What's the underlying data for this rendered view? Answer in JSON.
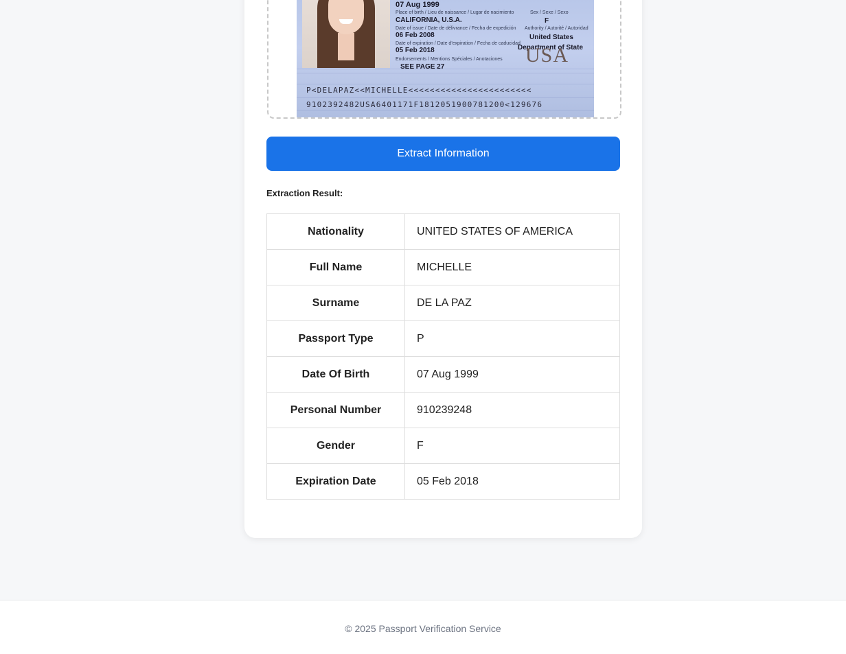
{
  "passport_image": {
    "date_of_birth": "07 Aug 1999",
    "place_of_birth_label": "Place of birth / Lieu de naissance / Lugar de nacimiento",
    "place_of_birth": "CALIFORNIA, U.S.A.",
    "sex_label": "Sex / Sexe / Sexo",
    "sex": "F",
    "issue_label": "Date of issue / Date de délivrance / Fecha de expedición",
    "issue_date": "06 Feb 2008",
    "authority_label": "Authority / Autorité / Autoridad",
    "authority_line1": "United States",
    "authority_line2": "Department of State",
    "expiration_label": "Date of expiration / Date d'expiration / Fecha de caducidad",
    "expiration_date": "05 Feb 2018",
    "endorsements_label": "Endorsements / Mentions Spéciales / Anotaciones",
    "endorsements": "SEE PAGE 27",
    "country_mark": "USA",
    "mrz_line1": "P<DELAPAZ<<MICHELLE<<<<<<<<<<<<<<<<<<<<<<<",
    "mrz_line2": "9102392482USA6401171F1812051900781200<129676"
  },
  "extract_button_label": "Extract Information",
  "result_title": "Extraction Result:",
  "result_rows": [
    {
      "label": "Nationality",
      "value": "UNITED STATES OF AMERICA"
    },
    {
      "label": "Full Name",
      "value": "MICHELLE"
    },
    {
      "label": "Surname",
      "value": "DE LA PAZ"
    },
    {
      "label": "Passport Type",
      "value": "P"
    },
    {
      "label": "Date Of Birth",
      "value": "07 Aug 1999"
    },
    {
      "label": "Personal Number",
      "value": "910239248"
    },
    {
      "label": "Gender",
      "value": "F"
    },
    {
      "label": "Expiration Date",
      "value": "05 Feb 2018"
    }
  ],
  "footer_text": "© 2025 Passport Verification Service",
  "colors": {
    "accent": "#1a73e8",
    "page_background": "#f6f7f9",
    "card_background": "#ffffff"
  }
}
